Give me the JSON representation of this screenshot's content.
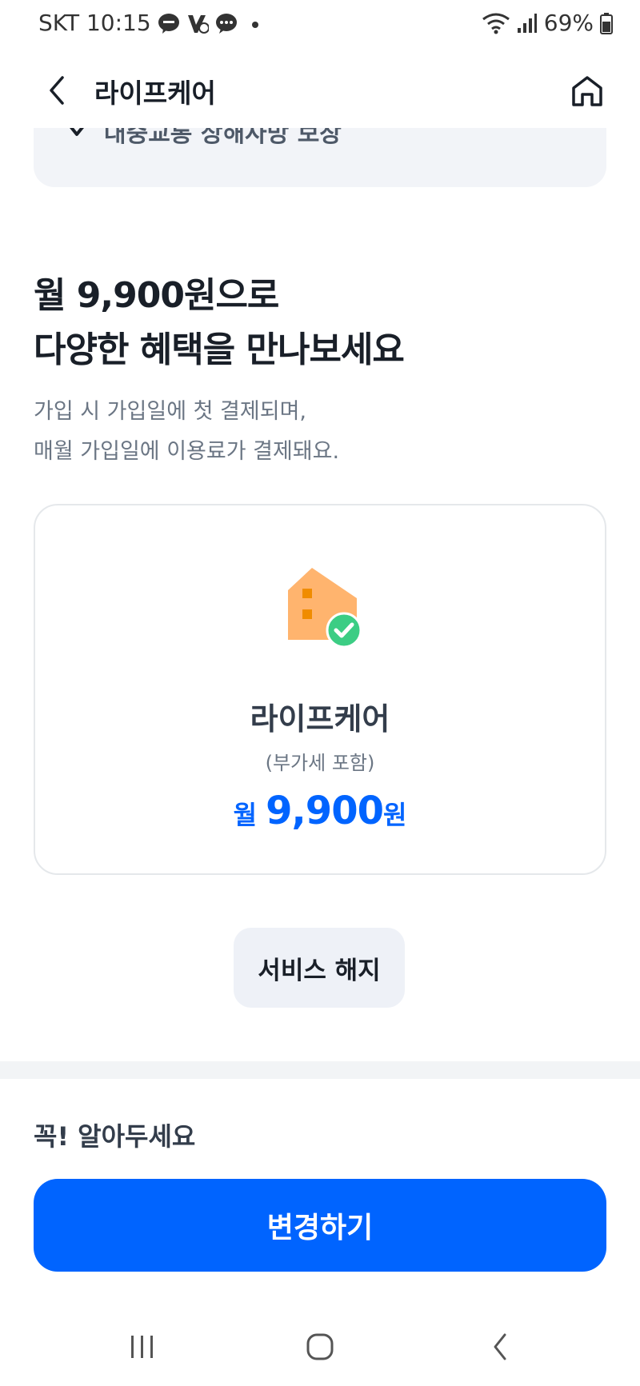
{
  "status_bar": {
    "carrier_time": "SKT 10:15",
    "battery": "69%"
  },
  "header": {
    "title": "라이프케어"
  },
  "top_card": {
    "item_text": "대중교통 상해사망 보장"
  },
  "intro": {
    "headline_line1": "월 9,900원으로",
    "headline_line2": "다양한 혜택을 만나보세요",
    "desc_line1": "가입 시 가입일에 첫 결제되며,",
    "desc_line2": "매월 가입일에 이용료가 결제돼요."
  },
  "plan": {
    "name": "라이프케어",
    "vat": "(부가세 포함)",
    "price_prefix": "월 ",
    "price_amount": "9,900",
    "price_suffix": "원",
    "icon": "building-check-icon"
  },
  "buttons": {
    "cancel": "서비스 해지",
    "change": "변경하기"
  },
  "notice": {
    "title": "꼭! 알아두세요"
  },
  "colors": {
    "primary": "#0064ff",
    "icon_orange": "#ffb46e",
    "icon_window": "#f08c00",
    "check_green": "#2ecc71",
    "card_bg": "#f2f4f8"
  }
}
